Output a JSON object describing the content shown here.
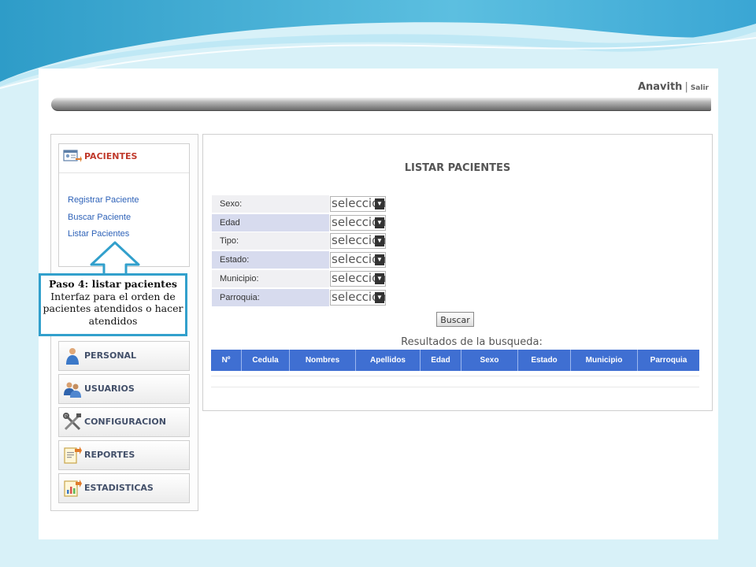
{
  "header": {
    "user_name": "Anavith",
    "separator": "|",
    "logout_label": "Salir"
  },
  "sidebar": {
    "pacientes": {
      "label": "PACIENTES",
      "submenu": [
        "Registrar  Paciente",
        "Buscar Paciente",
        "Listar Pacientes"
      ]
    },
    "items": [
      {
        "label": "PERSONAL",
        "icon": "person-icon"
      },
      {
        "label": "USUARIOS",
        "icon": "users-icon"
      },
      {
        "label": "CONFIGURACION",
        "icon": "tools-icon"
      },
      {
        "label": "REPORTES",
        "icon": "report-icon"
      },
      {
        "label": "ESTADISTICAS",
        "icon": "statistics-icon"
      }
    ]
  },
  "main": {
    "title": "LISTAR PACIENTES",
    "filters": [
      {
        "label": "Sexo:",
        "value": "seleccione"
      },
      {
        "label": "Edad",
        "value": "seleccione"
      },
      {
        "label": "Tipo:",
        "value": "seleccione"
      },
      {
        "label": "Estado:",
        "value": "seleccione"
      },
      {
        "label": "Municipio:",
        "value": "seleccione"
      },
      {
        "label": "Parroquia:",
        "value": "seleccione"
      }
    ],
    "search_button": "Buscar",
    "results_title": "Resultados de la busqueda:",
    "table_headers": [
      "Nº",
      "Cedula",
      "Nombres",
      "Apellidos",
      "Edad",
      "Sexo",
      "Estado",
      "Municipio",
      "Parroquia"
    ]
  },
  "callout": {
    "title": "Paso 4: listar pacientes",
    "text": "Interfaz para el orden de pacientes atendidos o hacer atendidos"
  },
  "colors": {
    "slide_background": "#d8f1f8",
    "table_header": "#3f6fd2",
    "callout_border": "#32a0cc",
    "pacientes_label": "#c0392b",
    "link": "#2e62b8"
  }
}
